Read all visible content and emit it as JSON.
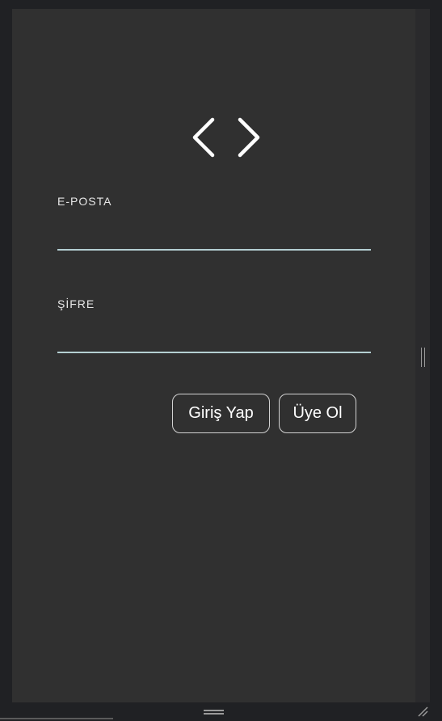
{
  "logo": {
    "icon": "code-brackets-icon",
    "color": "#ffffff"
  },
  "form": {
    "email_label": "E-POSTA",
    "email_value": "",
    "password_label": "ŞİFRE",
    "password_value": ""
  },
  "actions": {
    "login_label": "Giriş Yap",
    "register_label": "Üye Ol"
  },
  "colors": {
    "background": "#303030",
    "underline": "#b4cfd2",
    "button_border": "#d2d2d2"
  }
}
